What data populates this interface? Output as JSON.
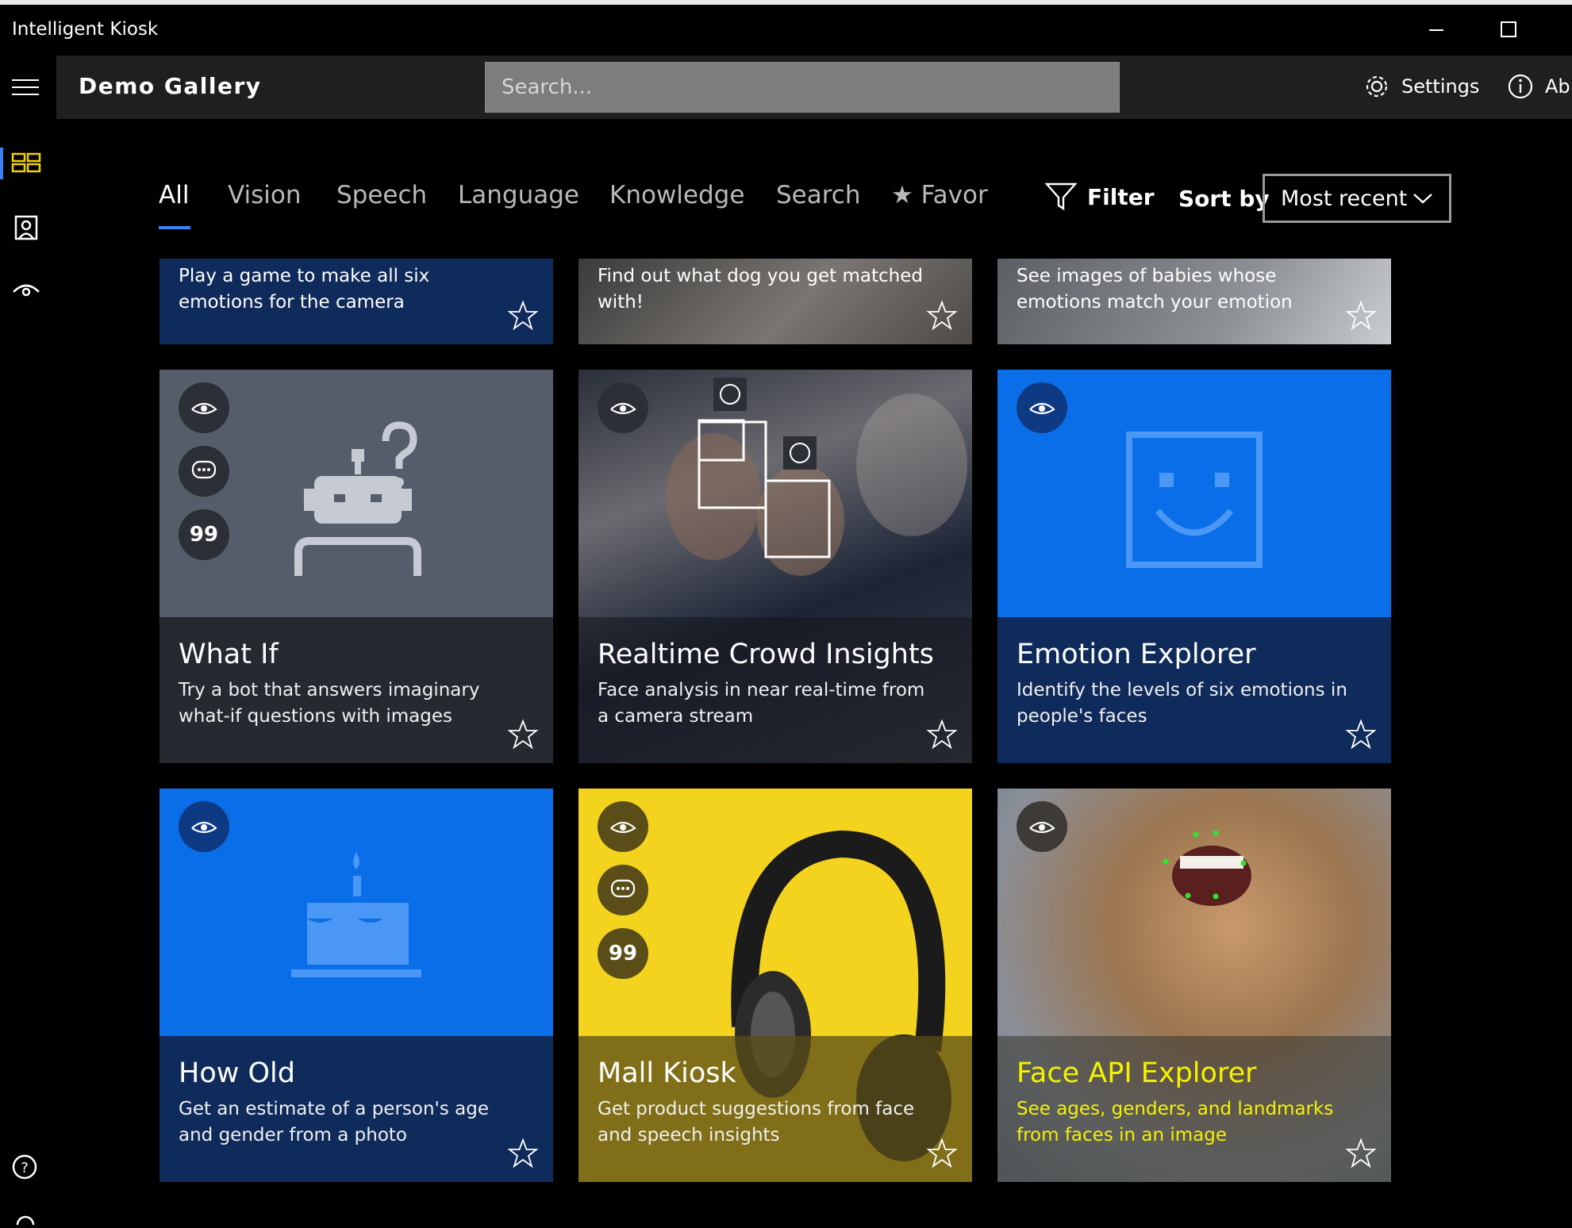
{
  "window": {
    "title": "Intelligent Kiosk"
  },
  "header": {
    "title": "Demo Gallery",
    "search_placeholder": "Search...",
    "settings_label": "Settings",
    "about_label": "Ab"
  },
  "tabs": [
    {
      "label": "All"
    },
    {
      "label": "Vision"
    },
    {
      "label": "Speech"
    },
    {
      "label": "Language"
    },
    {
      "label": "Knowledge"
    },
    {
      "label": "Search"
    },
    {
      "label": "★ Favor"
    }
  ],
  "filter_label": "Filter",
  "sort": {
    "label": "Sort by",
    "selected": "Most recent"
  },
  "top_row": [
    {
      "desc": "Play a game to make all six emotions for the camera"
    },
    {
      "desc": "Find out what dog you get matched with!"
    },
    {
      "desc": "See images of babies whose emotions match your emotion"
    }
  ],
  "cards": [
    {
      "title": "What If",
      "desc": "Try a bot that answers imaginary what-if questions with images"
    },
    {
      "title": "Realtime Crowd Insights",
      "desc": "Face analysis in near real-time from a camera stream"
    },
    {
      "title": "Emotion Explorer",
      "desc": "Identify the levels of six emotions in people's faces"
    },
    {
      "title": "How Old",
      "desc": "Get an estimate of a person's age and gender from a photo"
    },
    {
      "title": "Mall Kiosk",
      "desc": "Get product suggestions from face and speech insights"
    },
    {
      "title": "Face API Explorer",
      "desc": "See ages, genders, and landmarks from faces in an image"
    }
  ],
  "badge_text": "99",
  "colors": {
    "accent": "#3a82f7",
    "card_blue": "#0a6ee8",
    "card_caption_dark": "#0f2b5b",
    "face_api_caption_text": "#f5f200"
  }
}
